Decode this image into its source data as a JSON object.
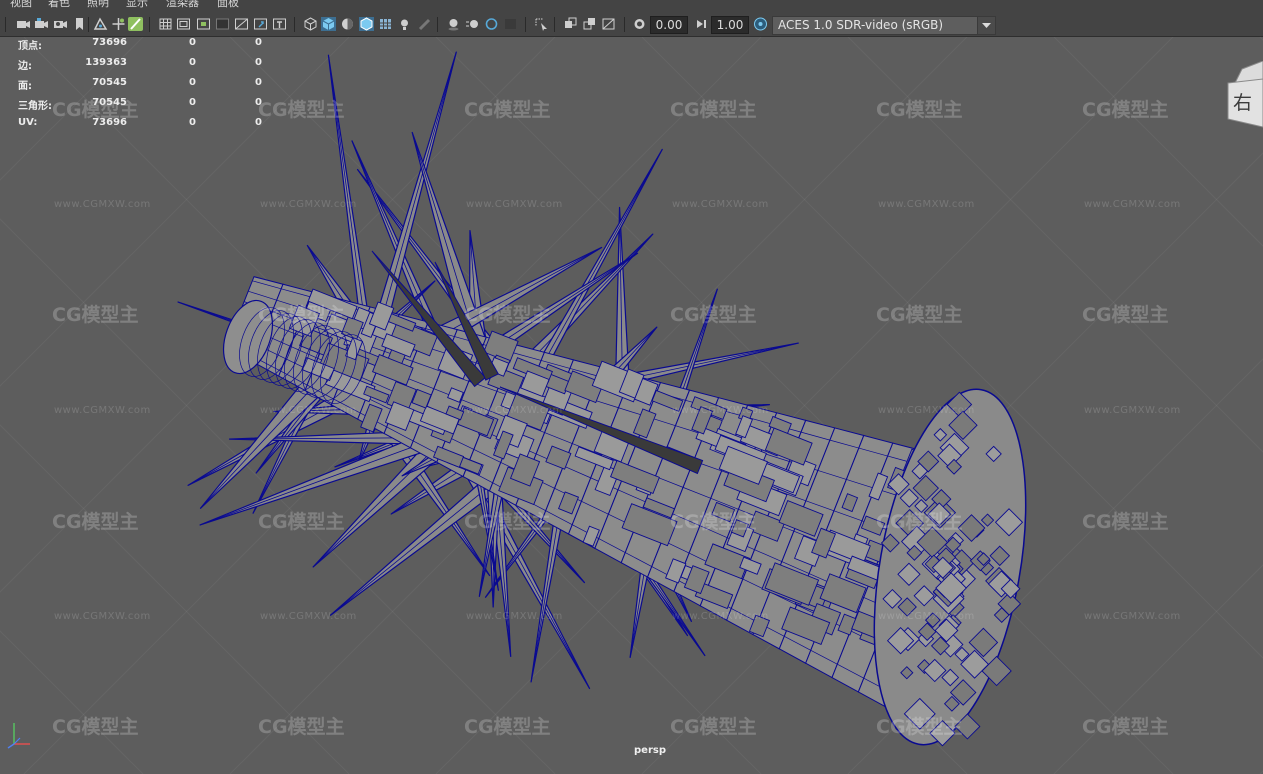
{
  "menu": [
    "视图",
    "着色",
    "照明",
    "显示",
    "渲染器",
    "面板"
  ],
  "toolbar": {
    "icons": [
      "camera-select-icon",
      "camera-attributes-icon",
      "bookmark-camera-icon",
      "bookmark-icon",
      "image-plane-icon",
      "two-d-pan-icon",
      "grease-pencil-icon",
      "grid-icon",
      "film-gate-icon",
      "resolution-gate-icon",
      "gate-mask-icon",
      "field-chart-icon",
      "safe-title-icon",
      "wireframe-icon",
      "smooth-shade-icon",
      "default-material-icon",
      "wireframe-on-shaded-icon",
      "use-all-lights-icon",
      "shadows-icon",
      "screen-space-ao-icon",
      "motion-blur-icon",
      "multisample-aa-icon",
      "depth-of-field-icon",
      "isolate-select-icon",
      "xray-icon",
      "xray-active-components-icon",
      "xray-joints-icon",
      "exposure-icon",
      "gamma-icon",
      "color-management-icon"
    ],
    "exposure_value": "0.00",
    "gamma_value": "1.00",
    "view_transform": "ACES 1.0 SDR-video (sRGB)"
  },
  "hud": [
    {
      "label": "顶点:",
      "values": [
        "73696",
        "0",
        "0"
      ]
    },
    {
      "label": "边:",
      "values": [
        "139363",
        "0",
        "0"
      ]
    },
    {
      "label": "面:",
      "values": [
        "70545",
        "0",
        "0"
      ]
    },
    {
      "label": "三角形:",
      "values": [
        "70545",
        "0",
        "0"
      ]
    },
    {
      "label": "UV:",
      "values": [
        "73696",
        "0",
        "0"
      ]
    }
  ],
  "viewcube": {
    "face": "右"
  },
  "camera": "persp",
  "watermark": {
    "logo": "CG模型主",
    "url": "www.CGMXW.com"
  },
  "colors": {
    "menubar": "#444444",
    "viewport": "#5d5d5d",
    "wire": "#0a0a90",
    "mesh_fill": "#8a8a8a",
    "accent_active": "#57a9d8"
  }
}
